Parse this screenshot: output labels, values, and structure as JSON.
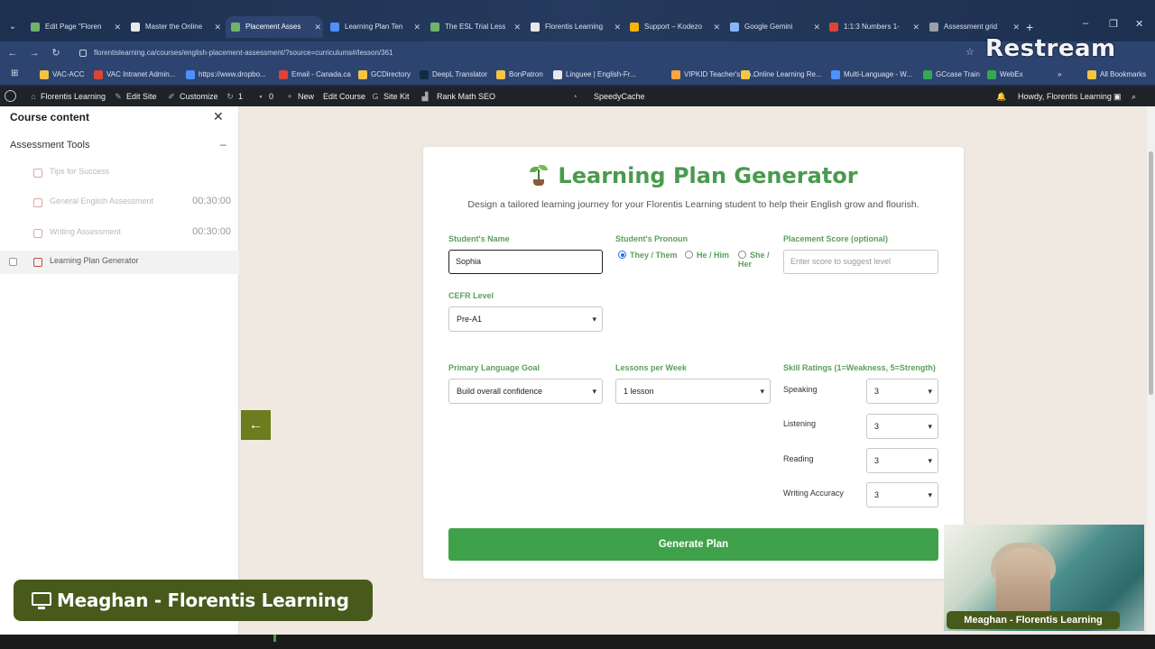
{
  "browser": {
    "tabs": [
      {
        "title": "Edit Page \"Floren",
        "color": "#6fb36a"
      },
      {
        "title": "Master the Online",
        "color": "#e8e8e8"
      },
      {
        "title": "Placement Asses",
        "color": "#6fb36a"
      },
      {
        "title": "Learning Plan Ten",
        "color": "#4d90fe"
      },
      {
        "title": "The ESL Trial Less",
        "color": "#6fb36a"
      },
      {
        "title": "Florentis Learning",
        "color": "#e8e8e8"
      },
      {
        "title": "Support – Kodezo",
        "color": "#f4b400"
      },
      {
        "title": "Google Gemini",
        "color": "#8ab4f8"
      },
      {
        "title": "1:1:3 Numbers 1-",
        "color": "#db4437"
      },
      {
        "title": "Assessment grid",
        "color": "#9aa0a6"
      }
    ],
    "url": "florentislearning.ca/courses/english-placement-assessment/?source=curriculums#/lesson/361",
    "overlay_brand": "Restream",
    "bookmarks": [
      {
        "label": "VAC-ACC",
        "color": "#f4c542"
      },
      {
        "label": "VAC Intranet Admin...",
        "color": "#db4437"
      },
      {
        "label": "https://www.dropbo...",
        "color": "#4d90fe"
      },
      {
        "label": "Email - Canada.ca",
        "color": "#db4437"
      },
      {
        "label": "GCDirectory",
        "color": "#f4c542"
      },
      {
        "label": "DeepL Translator",
        "color": "#0f2b46"
      },
      {
        "label": "BonPatron",
        "color": "#f4c542"
      },
      {
        "label": "Linguee | English-Fr...",
        "color": "#e8e8e8"
      },
      {
        "label": "VIPKID Teacher's Po...",
        "color": "#f4a742"
      },
      {
        "label": "Online Learning Re...",
        "color": "#f4c542"
      },
      {
        "label": "Multi-Language - W...",
        "color": "#4d90fe"
      },
      {
        "label": "GCcase Train",
        "color": "#34a853"
      },
      {
        "label": "WebEx",
        "color": "#34a853"
      }
    ],
    "all_bookmarks": "All Bookmarks"
  },
  "wp_admin": {
    "site_name": "Florentis Learning",
    "edit_site": "Edit Site",
    "customize": "Customize",
    "updates_count": "1",
    "comments_count": "0",
    "new": "New",
    "edit_course": "Edit Course",
    "site_kit": "Site Kit",
    "rank_math": "Rank Math SEO",
    "speedycache": "SpeedyCache",
    "howdy": "Howdy, Florentis Learning"
  },
  "sidebar": {
    "title": "Course content",
    "section": "Assessment Tools",
    "lessons": [
      {
        "name": "Tips for Success",
        "duration": ""
      },
      {
        "name": "General English Assessment",
        "duration": "00:30:00"
      },
      {
        "name": "Writing Assessment",
        "duration": "00:30:00"
      },
      {
        "name": "Learning Plan Generator",
        "duration": ""
      }
    ]
  },
  "card": {
    "title": "Learning Plan Generator",
    "subtitle": "Design a tailored learning journey for your Florentis Learning student to help their English grow and flourish.",
    "student_name_label": "Student's Name",
    "student_name_value": "Sophia",
    "pronoun_label": "Student's Pronoun",
    "pronouns": [
      "They / Them",
      "He / Him",
      "She / Her"
    ],
    "pronoun_selected": "They / Them",
    "placement_label": "Placement Score (optional)",
    "placement_placeholder": "Enter score to suggest level",
    "cefr_label": "CEFR Level",
    "cefr_value": "Pre-A1",
    "goal_label": "Primary Language Goal",
    "goal_value": "Build overall confidence",
    "lessons_label": "Lessons per Week",
    "lessons_value": "1 lesson",
    "skills_label": "Skill Ratings (1=Weakness, 5=Strength)",
    "skills": [
      {
        "name": "Speaking",
        "value": "3"
      },
      {
        "name": "Listening",
        "value": "3"
      },
      {
        "name": "Reading",
        "value": "3"
      },
      {
        "name": "Writing Accuracy",
        "value": "3"
      }
    ],
    "generate_button": "Generate Plan"
  },
  "overlays": {
    "name_banner": "Meaghan - Florentis Learning",
    "webcam_label": "Meaghan - Florentis Learning"
  }
}
